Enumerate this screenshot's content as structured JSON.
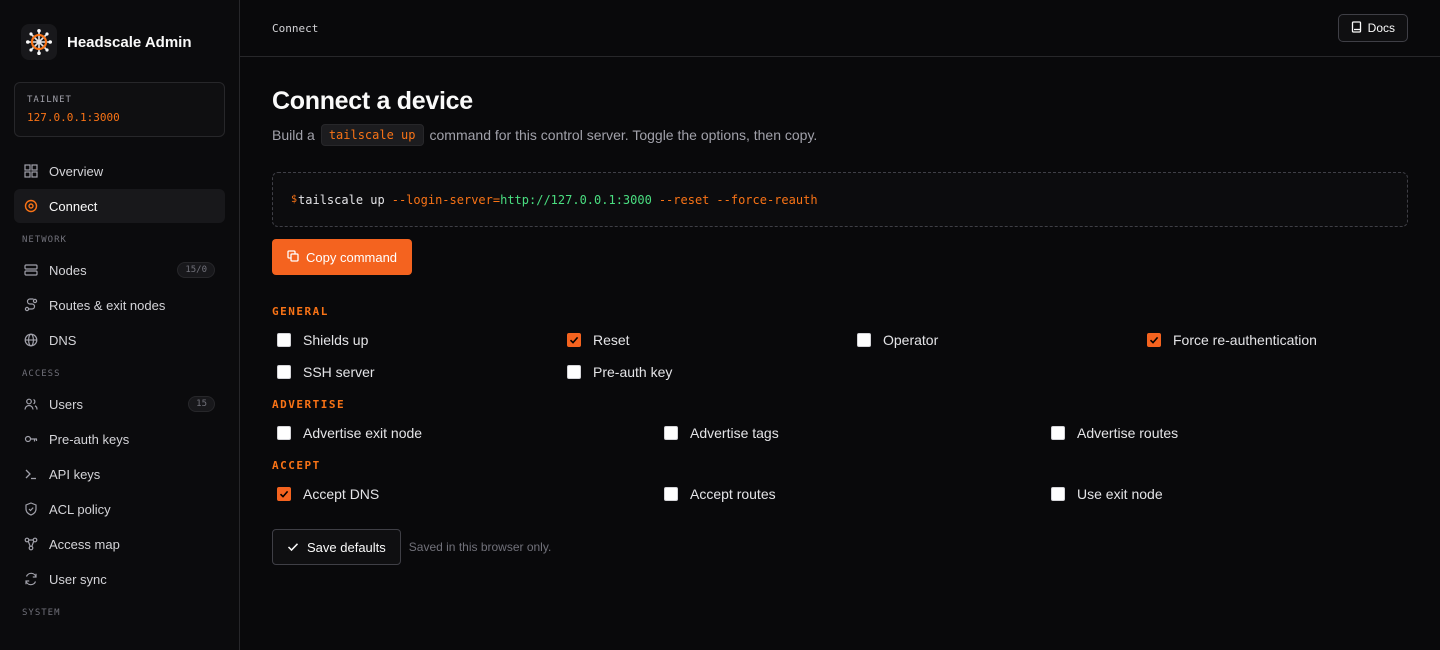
{
  "brand": {
    "name": "Headscale Admin"
  },
  "tailnet": {
    "label": "TAILNET",
    "value": "127.0.0.1:3000"
  },
  "sidebar": {
    "top_items": [
      {
        "label": "Overview",
        "icon": "grid-icon"
      },
      {
        "label": "Connect",
        "icon": "target-icon",
        "active": true
      }
    ],
    "network_label": "NETWORK",
    "network_items": [
      {
        "label": "Nodes",
        "icon": "server-icon",
        "badge": "15/0"
      },
      {
        "label": "Routes & exit nodes",
        "icon": "route-icon"
      },
      {
        "label": "DNS",
        "icon": "globe-icon"
      }
    ],
    "access_label": "ACCESS",
    "access_items": [
      {
        "label": "Users",
        "icon": "users-icon",
        "badge": "15"
      },
      {
        "label": "Pre-auth keys",
        "icon": "key-icon"
      },
      {
        "label": "API keys",
        "icon": "terminal-icon"
      },
      {
        "label": "ACL policy",
        "icon": "shield-icon"
      },
      {
        "label": "Access map",
        "icon": "network-icon"
      },
      {
        "label": "User sync",
        "icon": "refresh-icon"
      }
    ],
    "system_label": "SYSTEM"
  },
  "topbar": {
    "breadcrumb": "Connect",
    "docs_label": "Docs"
  },
  "page": {
    "title": "Connect a device",
    "subtitle_pre": "Build a",
    "subtitle_code": "tailscale up",
    "subtitle_post": "command for this control server. Toggle the options, then copy."
  },
  "command": {
    "dollar": "$",
    "base": "tailscale up",
    "login_flag": "--login-server=",
    "login_value": "http://127.0.0.1:3000",
    "flag_reset": "--reset",
    "flag_force": "--force-reauth"
  },
  "copy_label": "Copy command",
  "groups": {
    "general": {
      "title": "GENERAL",
      "options": [
        {
          "label": "Shields up",
          "checked": false
        },
        {
          "label": "Reset",
          "checked": true
        },
        {
          "label": "Operator",
          "checked": false
        },
        {
          "label": "Force re-authentication",
          "checked": true
        },
        {
          "label": "SSH server",
          "checked": false
        },
        {
          "label": "Pre-auth key",
          "checked": false
        }
      ]
    },
    "advertise": {
      "title": "ADVERTISE",
      "options": [
        {
          "label": "Advertise exit node",
          "checked": false
        },
        {
          "label": "Advertise tags",
          "checked": false
        },
        {
          "label": "Advertise routes",
          "checked": false
        }
      ]
    },
    "accept": {
      "title": "ACCEPT",
      "options": [
        {
          "label": "Accept DNS",
          "checked": true
        },
        {
          "label": "Accept routes",
          "checked": false
        },
        {
          "label": "Use exit node",
          "checked": false
        }
      ]
    }
  },
  "save": {
    "label": "Save defaults",
    "note": "Saved in this browser only."
  },
  "colors": {
    "accent": "#f4631f",
    "success": "#4ade80",
    "background": "#09090b"
  }
}
